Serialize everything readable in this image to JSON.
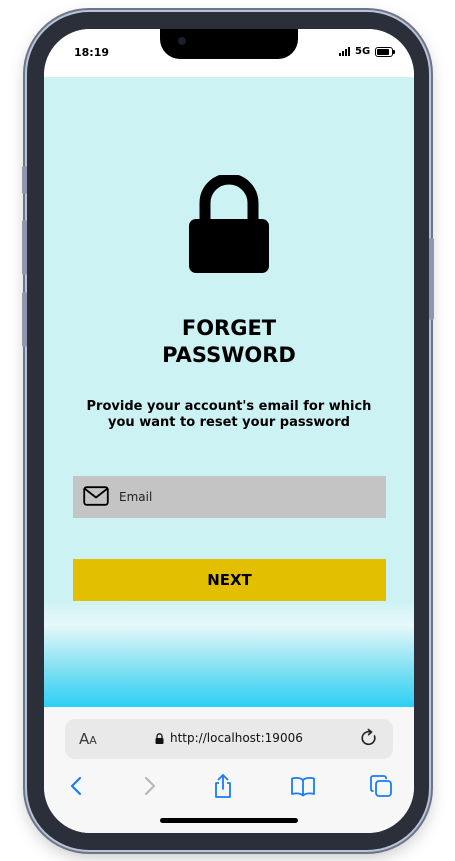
{
  "status_bar": {
    "time": "18:19",
    "network": "5G"
  },
  "page": {
    "title_line1": "FORGET",
    "title_line2": "PASSWORD",
    "subtitle": "Provide your account's email for which you want to reset your password",
    "email_placeholder": "Email",
    "email_value": "",
    "next_label": "NEXT"
  },
  "browser": {
    "text_size_label": "A",
    "text_size_label_small": "A",
    "url": "http://localhost:19006"
  },
  "icons": {
    "lock": "lock-icon",
    "mail": "mail-icon",
    "padlock": "padlock-icon",
    "reload": "reload-icon",
    "back": "chevron-left-icon",
    "forward": "chevron-right-icon",
    "share": "share-icon",
    "bookmarks": "book-icon",
    "tabs": "tabs-icon"
  },
  "colors": {
    "background": "#cdf2f4",
    "field_bg": "#c4c4c4",
    "button_bg": "#e2bf00",
    "browser_accent": "#1a7cf5",
    "gradient_bottom": "#2dcff6"
  }
}
